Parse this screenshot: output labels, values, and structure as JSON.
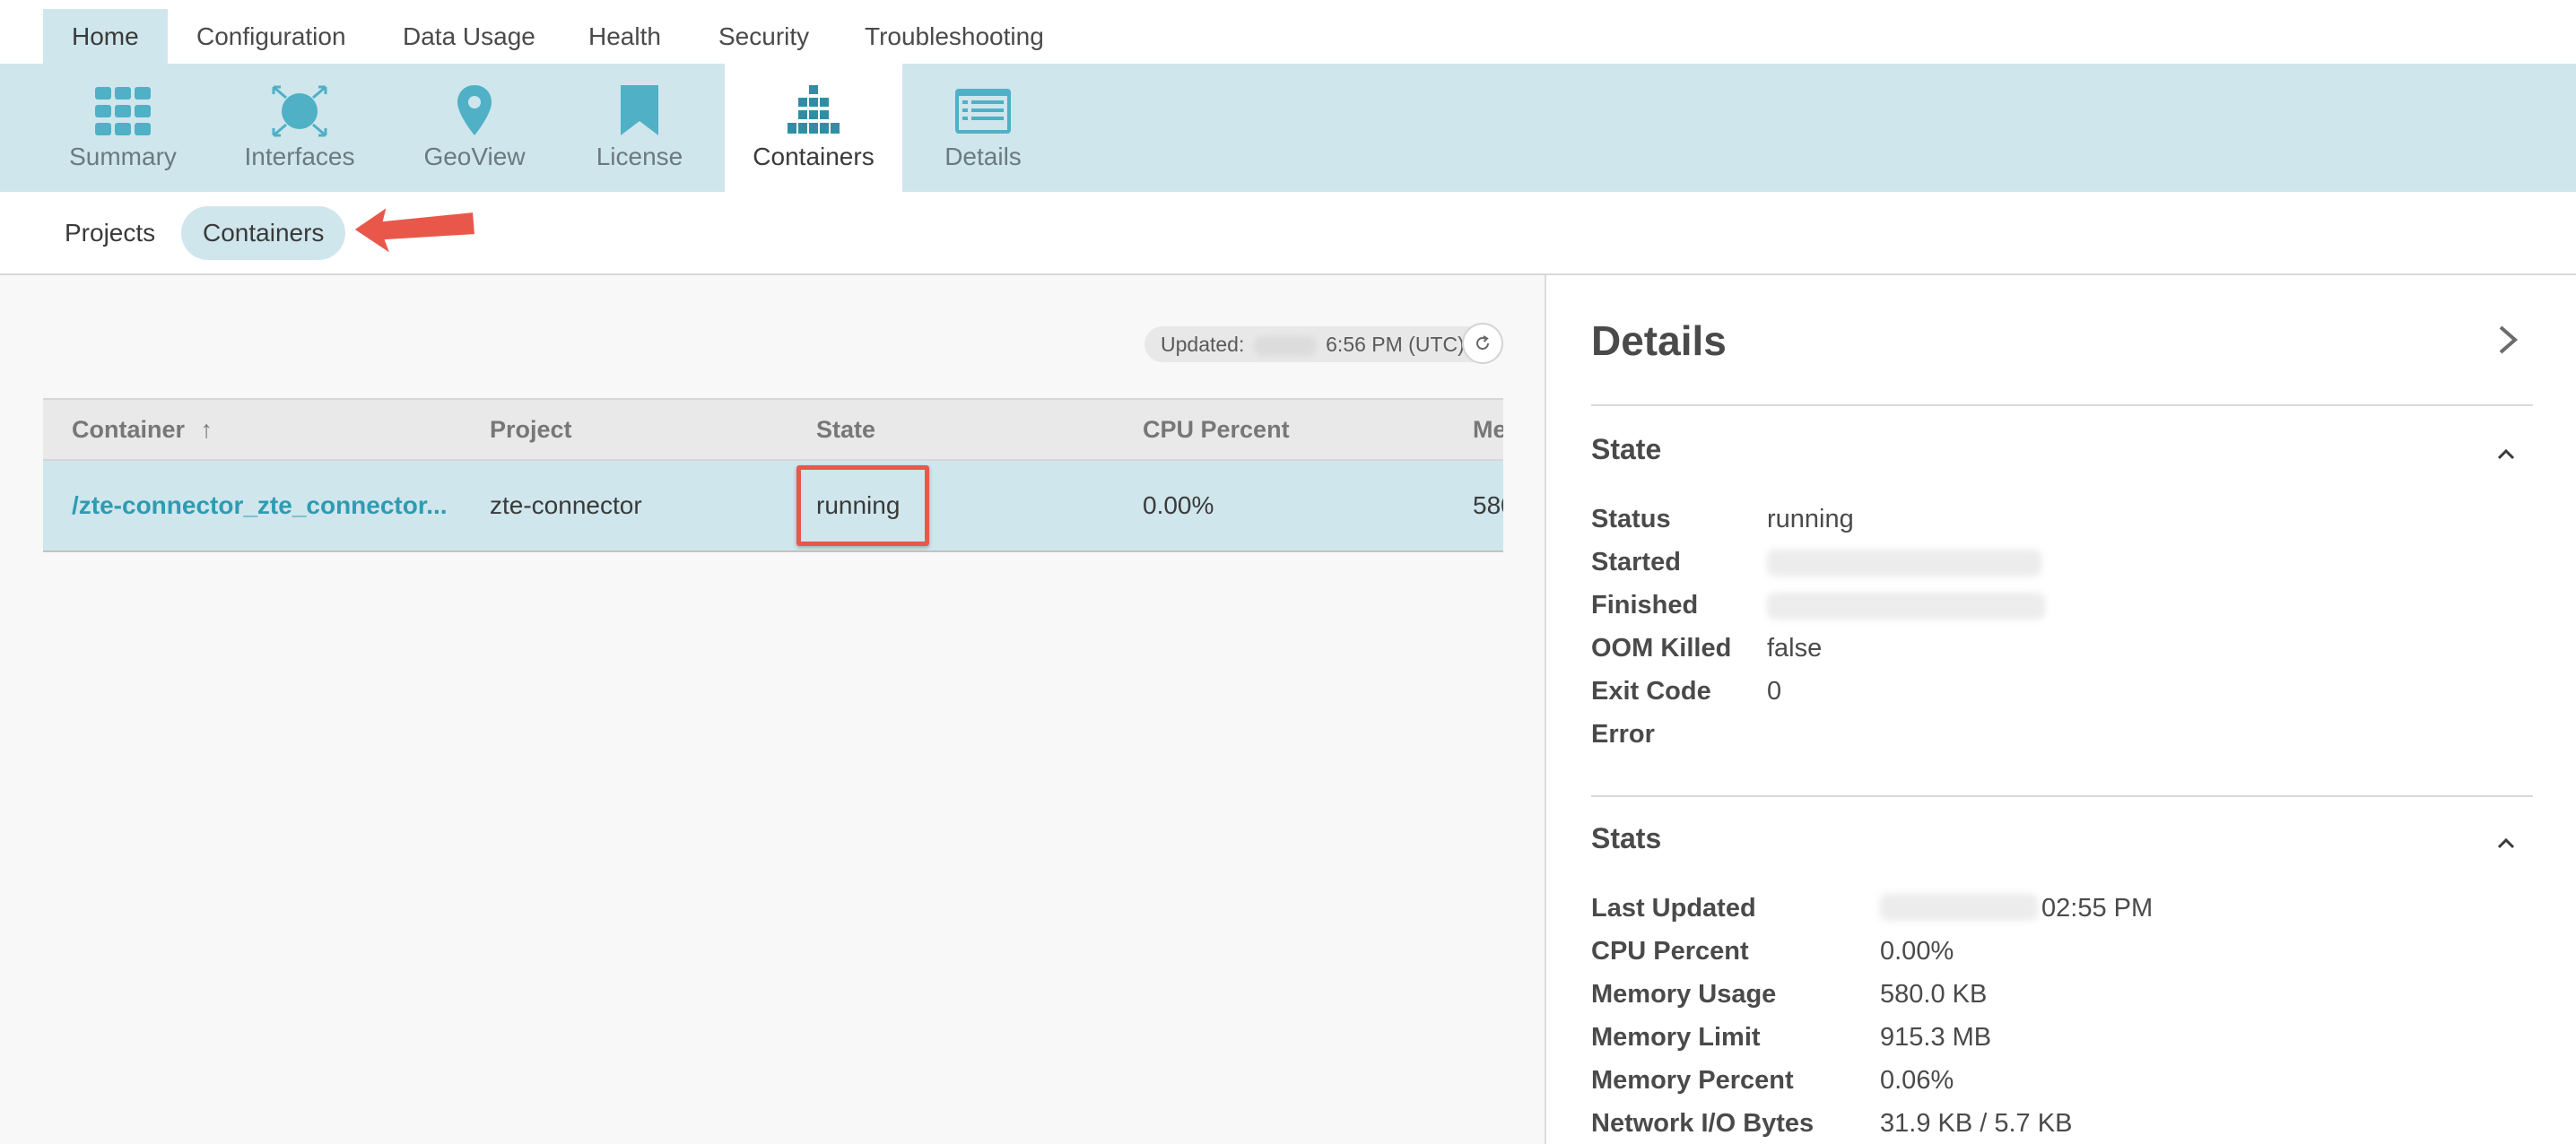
{
  "top_tabs": [
    {
      "label": "Home"
    },
    {
      "label": "Configuration"
    },
    {
      "label": "Data Usage"
    },
    {
      "label": "Health"
    },
    {
      "label": "Security"
    },
    {
      "label": "Troubleshooting"
    }
  ],
  "icon_tabs": [
    {
      "label": "Summary",
      "icon": "grid-icon"
    },
    {
      "label": "Interfaces",
      "icon": "network-hub-icon"
    },
    {
      "label": "GeoView",
      "icon": "map-pin-icon"
    },
    {
      "label": "License",
      "icon": "bookmark-icon"
    },
    {
      "label": "Containers",
      "icon": "containers-stack-icon"
    },
    {
      "label": "Details",
      "icon": "list-card-icon"
    }
  ],
  "sub_tabs": [
    {
      "label": "Projects"
    },
    {
      "label": "Containers"
    }
  ],
  "updated": {
    "label": "Updated:",
    "time": "6:56 PM (UTC)"
  },
  "table": {
    "columns": [
      "Container",
      "Project",
      "State",
      "CPU Percent",
      "Me"
    ],
    "sort_indicator": "↑",
    "rows": [
      {
        "container": "/zte-connector_zte_connector...",
        "project": "zte-connector",
        "state": "running",
        "cpu": "0.00%",
        "mem": "580"
      }
    ]
  },
  "details": {
    "title": "Details",
    "state": {
      "title": "State",
      "items": [
        {
          "label": "Status",
          "value": "running"
        },
        {
          "label": "Started",
          "value": ""
        },
        {
          "label": "Finished",
          "value": ""
        },
        {
          "label": "OOM Killed",
          "value": "false"
        },
        {
          "label": "Exit Code",
          "value": "0"
        },
        {
          "label": "Error",
          "value": ""
        }
      ]
    },
    "stats": {
      "title": "Stats",
      "items": [
        {
          "label": "Last Updated",
          "value": "02:55 PM"
        },
        {
          "label": "CPU Percent",
          "value": "0.00%"
        },
        {
          "label": "Memory Usage",
          "value": "580.0 KB"
        },
        {
          "label": "Memory Limit",
          "value": "915.3 MB"
        },
        {
          "label": "Memory Percent",
          "value": "0.06%"
        },
        {
          "label": "Network I/O Bytes",
          "value": "31.9 KB / 5.7 KB"
        }
      ]
    }
  },
  "colors": {
    "accent": "#2f9bb2",
    "band": "#cfe6ec",
    "annotation": "#e9574a"
  }
}
